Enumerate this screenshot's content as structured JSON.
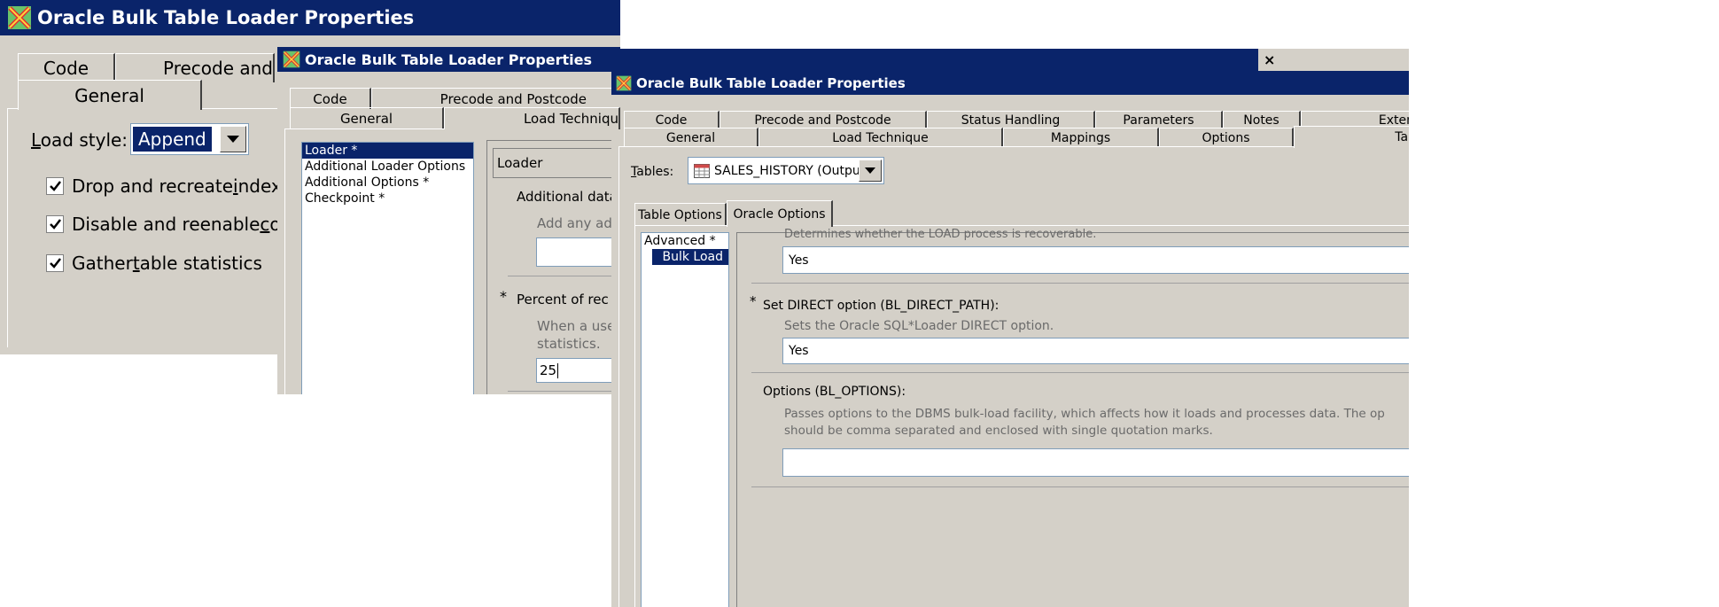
{
  "win1": {
    "title": "Oracle Bulk Table Loader Properties",
    "tabs_row1": [
      "Code",
      "Precode and"
    ],
    "tab_general": "General",
    "load_style_label_u": "L",
    "load_style_label_rest": "oad style:",
    "load_style_value": "Append",
    "checkboxes": [
      {
        "pre": "Drop and recreate ",
        "u": "i",
        "post": "ndexe",
        "checked": true
      },
      {
        "pre": "Disable and reenable ",
        "u": "c",
        "post": "ons",
        "checked": true
      },
      {
        "pre": "Gather ",
        "u": "t",
        "post": "able statistics",
        "checked": true
      }
    ]
  },
  "win2": {
    "title": "Oracle Bulk Table Loader Properties",
    "tabs_row1": [
      "Code",
      "Precode and Postcode"
    ],
    "tabs_row2": [
      "General",
      "Load Techniqu"
    ],
    "list_items": [
      "Loader *",
      "Additional Loader Options",
      "Additional Options *",
      "Checkpoint *"
    ],
    "selected_item": "Loader *",
    "section_header": "Loader",
    "additional_data_label": "Additional data",
    "additional_data_desc": "Add any ad",
    "required_mark": "*",
    "percent_label": "Percent of rec",
    "percent_desc1": "When a use",
    "percent_desc2": "statistics.",
    "percent_value": "25"
  },
  "win3": {
    "title": "Oracle Bulk Table Loader Properties",
    "close_glyph": "×",
    "tabs_row1": [
      "Code",
      "Precode and Postcode",
      "Status Handling",
      "Parameters",
      "Notes",
      "Exten"
    ],
    "tabs_row2": [
      "General",
      "Load Technique",
      "Mappings",
      "Options",
      "Tab"
    ],
    "tables_label_u": "T",
    "tables_label_rest": "ables:",
    "tables_value": "SALES_HISTORY (Output)",
    "subtabs": [
      "Table Options",
      "Oracle Options"
    ],
    "tree_items": [
      "Advanced *",
      "Bulk Load"
    ],
    "recoverable_desc": "Determines whether the LOAD process is recoverable.",
    "recoverable_value": "Yes",
    "required_mark": "*",
    "direct_label": "Set DIRECT option (BL_DIRECT_PATH):",
    "direct_desc": "Sets the Oracle SQL*Loader DIRECT option.",
    "direct_value": "Yes",
    "options_label": "Options (BL_OPTIONS):",
    "options_desc1": "Passes options to the DBMS bulk-load facility, which affects how it loads and processes data. The op",
    "options_desc2": "should be comma separated and enclosed with single quotation marks.",
    "options_value": ""
  },
  "colors": {
    "titlebar": "#0a246a",
    "dialog": "#d4d0c8",
    "selection": "#0a246a"
  }
}
